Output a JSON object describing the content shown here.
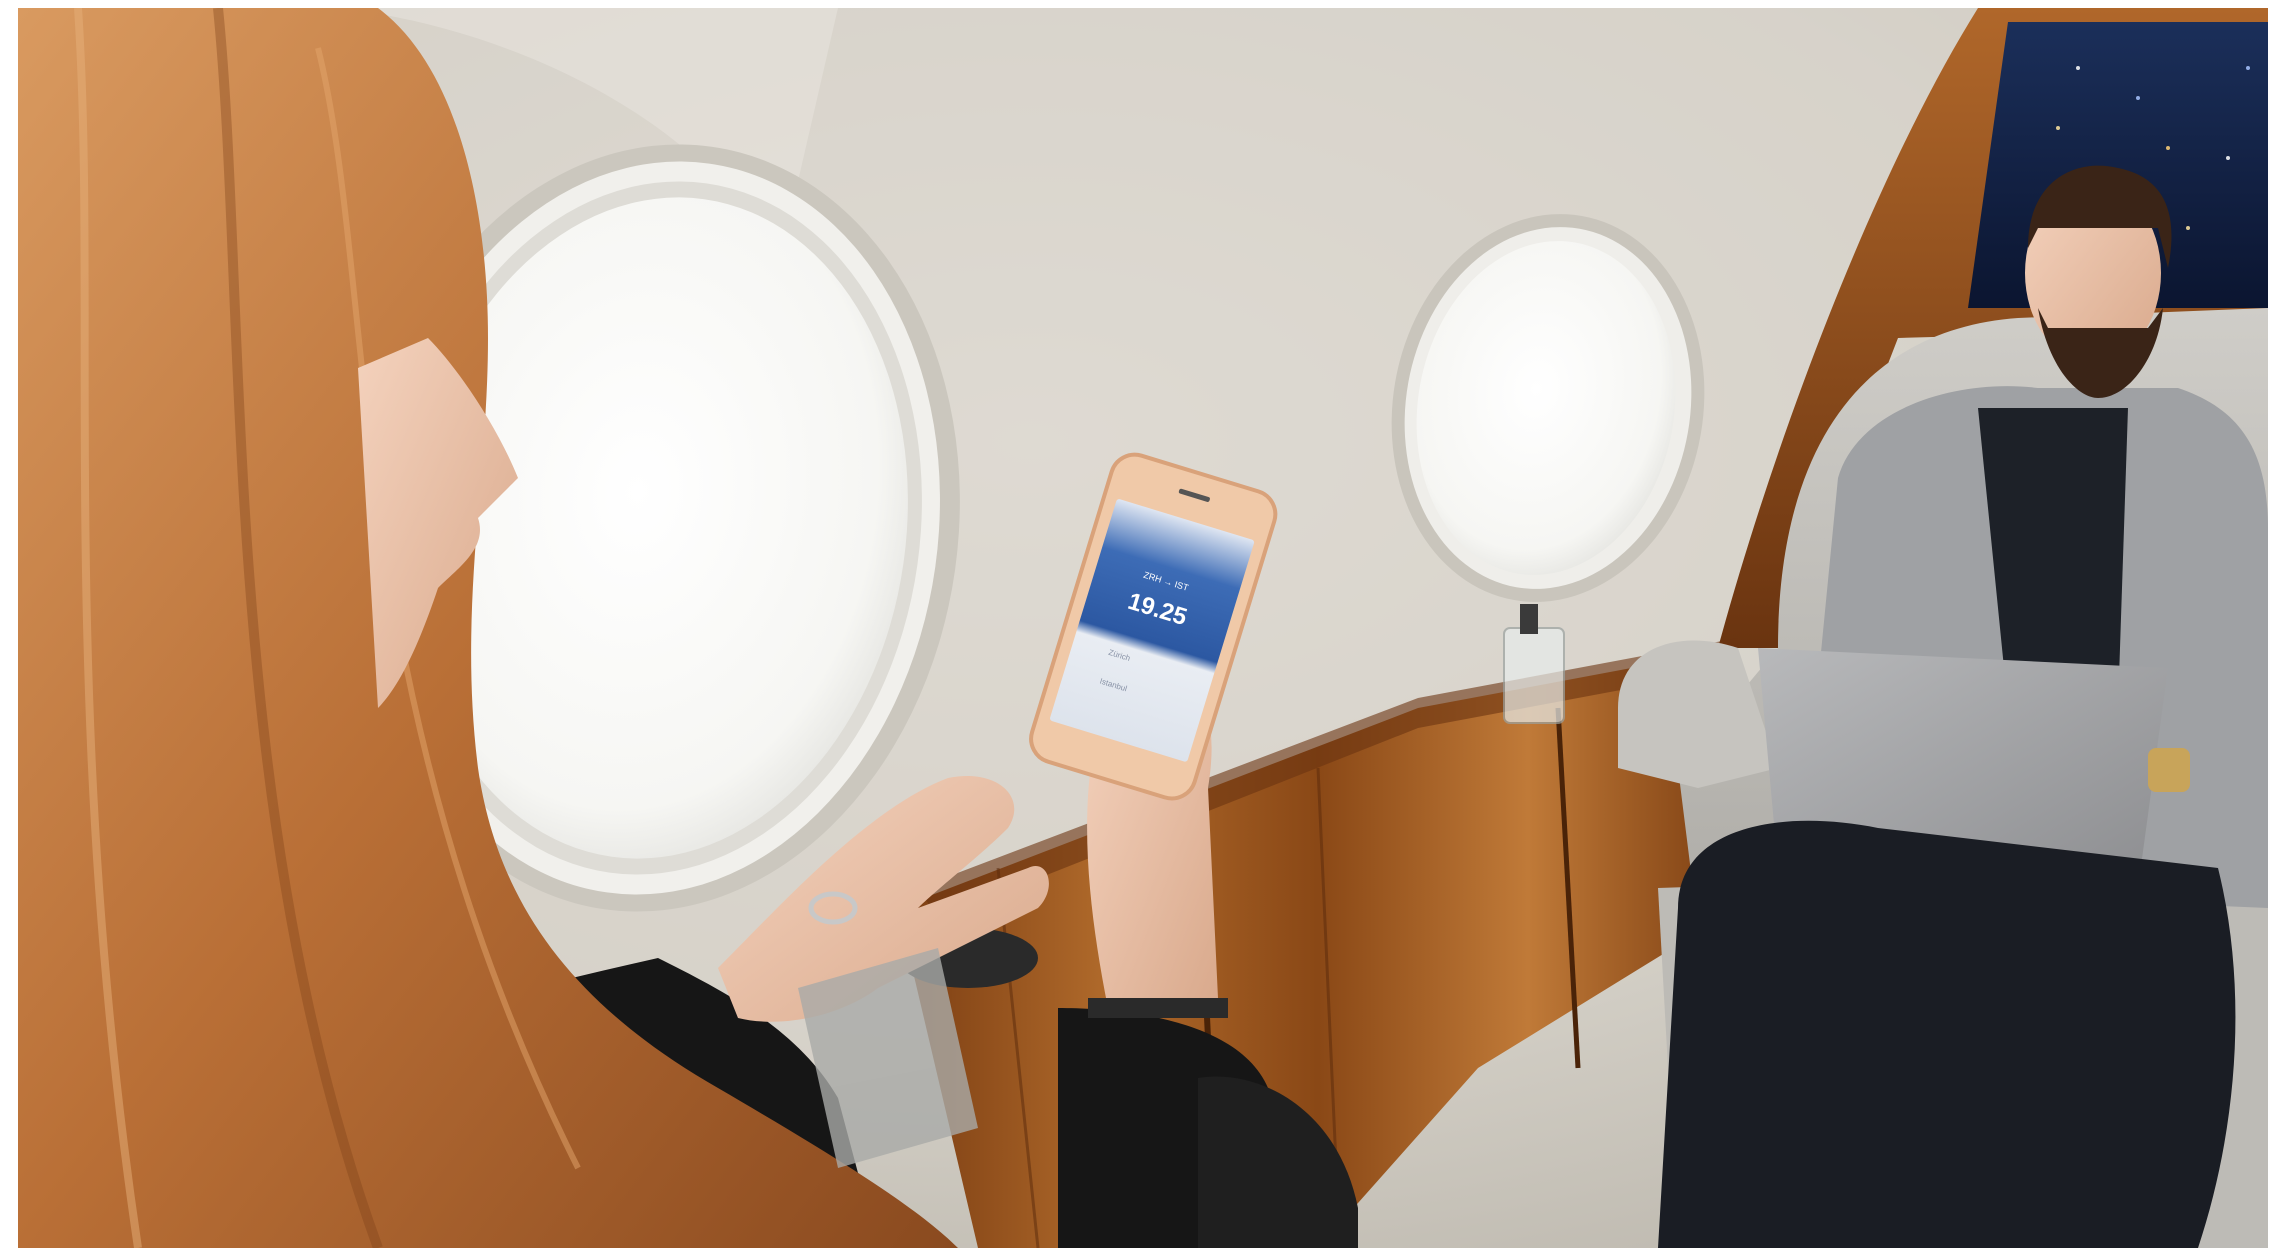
{
  "photo": {
    "subject": "cabin",
    "phone_screen": {
      "time_display": "19.25",
      "route_hint": "ZRH → IST",
      "small_labels": [
        "Zürich",
        "Istanbul"
      ]
    }
  },
  "colors": {
    "cabin_wall": "#dcd8d0",
    "window_glass": "#f9f9f7",
    "wood_panel": "#a15b1e",
    "seat_leather": "#bfbdb8",
    "phone_screen_blue": "#2f5ea8",
    "hair": "#c67d45"
  }
}
